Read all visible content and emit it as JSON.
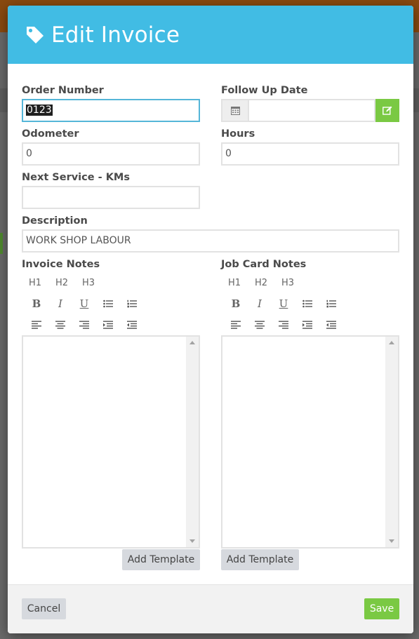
{
  "header": {
    "title": "Edit Invoice",
    "icon": "tag-icon",
    "color": "#41bce4"
  },
  "fields": {
    "order_number": {
      "label": "Order Number",
      "value": "0123"
    },
    "follow_up_date": {
      "label": "Follow Up Date",
      "value": ""
    },
    "odometer": {
      "label": "Odometer",
      "value": "0"
    },
    "hours": {
      "label": "Hours",
      "value": "0"
    },
    "next_service": {
      "label": "Next Service - KMs",
      "value": ""
    },
    "description": {
      "label": "Description",
      "value": "WORK SHOP LABOUR"
    }
  },
  "invoice_notes": {
    "label": "Invoice Notes",
    "add_template_label": "Add Template"
  },
  "job_card_notes": {
    "label": "Job Card Notes",
    "add_template_label": "Add Template"
  },
  "toolbar": {
    "h1": "H1",
    "h2": "H2",
    "h3": "H3",
    "bold": "B",
    "italic": "I",
    "underline": "U"
  },
  "footer": {
    "cancel_label": "Cancel",
    "save_label": "Save"
  },
  "colors": {
    "accent": "#41bce4",
    "success": "#7ac943",
    "button_gray": "#d6d9de"
  }
}
